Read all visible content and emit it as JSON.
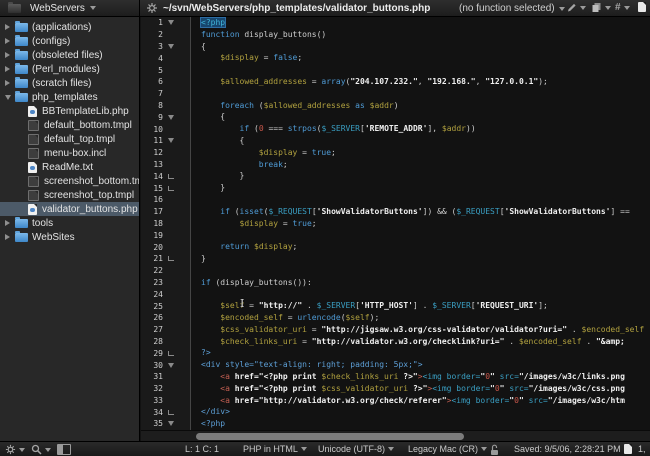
{
  "titlebar": {
    "sidebar_title": "WebServers",
    "path": "~/svn/WebServers/php_templates/validator_buttons.php",
    "function_selector": "(no function selected)",
    "tool_icons": [
      "gear-icon",
      "pencil-icon",
      "copy-icon",
      "hash-icon",
      "document-icon"
    ]
  },
  "sidebar": {
    "items": [
      {
        "label": "(applications)",
        "icon": "folder",
        "disclosure": "collapsed",
        "indent": 0,
        "selected": false
      },
      {
        "label": "(configs)",
        "icon": "folder",
        "disclosure": "collapsed",
        "indent": 0,
        "selected": false
      },
      {
        "label": "(obsoleted files)",
        "icon": "folder",
        "disclosure": "collapsed",
        "indent": 0,
        "selected": false
      },
      {
        "label": "(Perl_modules)",
        "icon": "folder",
        "disclosure": "collapsed",
        "indent": 0,
        "selected": false
      },
      {
        "label": "(scratch files)",
        "icon": "folder",
        "disclosure": "collapsed",
        "indent": 0,
        "selected": false
      },
      {
        "label": "php_templates",
        "icon": "folder",
        "disclosure": "expanded",
        "indent": 0,
        "selected": false
      },
      {
        "label": "BBTemplateLib.php",
        "icon": "doc-php",
        "disclosure": "none",
        "indent": 1,
        "selected": false
      },
      {
        "label": "default_bottom.tmpl",
        "icon": "doc-dark",
        "disclosure": "none",
        "indent": 1,
        "selected": false
      },
      {
        "label": "default_top.tmpl",
        "icon": "doc-dark",
        "disclosure": "none",
        "indent": 1,
        "selected": false
      },
      {
        "label": "menu-box.incl",
        "icon": "doc-dark",
        "disclosure": "none",
        "indent": 1,
        "selected": false
      },
      {
        "label": "ReadMe.txt",
        "icon": "doc-php",
        "disclosure": "none",
        "indent": 1,
        "selected": false
      },
      {
        "label": "screenshot_bottom.tmpl",
        "icon": "doc-dark",
        "disclosure": "none",
        "indent": 1,
        "selected": false
      },
      {
        "label": "screenshot_top.tmpl",
        "icon": "doc-dark",
        "disclosure": "none",
        "indent": 1,
        "selected": false
      },
      {
        "label": "validator_buttons.php",
        "icon": "doc-php",
        "disclosure": "none",
        "indent": 1,
        "selected": true
      },
      {
        "label": "tools",
        "icon": "folder",
        "disclosure": "collapsed",
        "indent": 0,
        "selected": false
      },
      {
        "label": "WebSites",
        "icon": "folder",
        "disclosure": "collapsed",
        "indent": 0,
        "selected": false
      }
    ]
  },
  "editor": {
    "lines": [
      {
        "n": 1,
        "fold": "open",
        "segs": [
          {
            "t": "<?php",
            "c": "phpsel"
          }
        ]
      },
      {
        "n": 2,
        "fold": "",
        "segs": [
          {
            "t": "function",
            "c": "k"
          },
          {
            "t": " display_buttons()",
            "c": "p"
          }
        ]
      },
      {
        "n": 3,
        "fold": "open",
        "segs": [
          {
            "t": "{",
            "c": "p"
          }
        ]
      },
      {
        "n": 4,
        "fold": "",
        "segs": [
          {
            "t": "    ",
            "c": "p"
          },
          {
            "t": "$display",
            "c": "v"
          },
          {
            "t": " = ",
            "c": "p"
          },
          {
            "t": "false",
            "c": "k"
          },
          {
            "t": ";",
            "c": "p"
          }
        ]
      },
      {
        "n": 5,
        "fold": "",
        "segs": []
      },
      {
        "n": 6,
        "fold": "",
        "segs": [
          {
            "t": "    ",
            "c": "p"
          },
          {
            "t": "$allowed_addresses",
            "c": "v"
          },
          {
            "t": " = ",
            "c": "p"
          },
          {
            "t": "array",
            "c": "k"
          },
          {
            "t": "(",
            "c": "p"
          },
          {
            "t": "\"204.107.232.\"",
            "c": "s"
          },
          {
            "t": ", ",
            "c": "p"
          },
          {
            "t": "\"192.168.\"",
            "c": "s"
          },
          {
            "t": ", ",
            "c": "p"
          },
          {
            "t": "\"127.0.0.1\"",
            "c": "s"
          },
          {
            "t": ");",
            "c": "p"
          }
        ]
      },
      {
        "n": 7,
        "fold": "",
        "segs": []
      },
      {
        "n": 8,
        "fold": "",
        "segs": [
          {
            "t": "    ",
            "c": "p"
          },
          {
            "t": "foreach",
            "c": "k"
          },
          {
            "t": " (",
            "c": "p"
          },
          {
            "t": "$allowed_addresses",
            "c": "v"
          },
          {
            "t": " ",
            "c": "p"
          },
          {
            "t": "as",
            "c": "k"
          },
          {
            "t": " ",
            "c": "p"
          },
          {
            "t": "$addr",
            "c": "v"
          },
          {
            "t": ")",
            "c": "p"
          }
        ]
      },
      {
        "n": 9,
        "fold": "open",
        "segs": [
          {
            "t": "    {",
            "c": "p"
          }
        ]
      },
      {
        "n": 10,
        "fold": "",
        "segs": [
          {
            "t": "        ",
            "c": "p"
          },
          {
            "t": "if",
            "c": "k"
          },
          {
            "t": " (",
            "c": "p"
          },
          {
            "t": "0",
            "c": "n"
          },
          {
            "t": " === ",
            "c": "p"
          },
          {
            "t": "strpos",
            "c": "k"
          },
          {
            "t": "(",
            "c": "p"
          },
          {
            "t": "$_SERVER",
            "c": "g"
          },
          {
            "t": "[",
            "c": "p"
          },
          {
            "t": "'REMOTE_ADDR'",
            "c": "s"
          },
          {
            "t": "], ",
            "c": "p"
          },
          {
            "t": "$addr",
            "c": "v"
          },
          {
            "t": "))",
            "c": "p"
          }
        ]
      },
      {
        "n": 11,
        "fold": "open",
        "segs": [
          {
            "t": "        {",
            "c": "p"
          }
        ]
      },
      {
        "n": 12,
        "fold": "",
        "segs": [
          {
            "t": "            ",
            "c": "p"
          },
          {
            "t": "$display",
            "c": "v"
          },
          {
            "t": " = ",
            "c": "p"
          },
          {
            "t": "true",
            "c": "k"
          },
          {
            "t": ";",
            "c": "p"
          }
        ]
      },
      {
        "n": 13,
        "fold": "",
        "segs": [
          {
            "t": "            ",
            "c": "p"
          },
          {
            "t": "break",
            "c": "k"
          },
          {
            "t": ";",
            "c": "p"
          }
        ]
      },
      {
        "n": 14,
        "fold": "end",
        "segs": [
          {
            "t": "        }",
            "c": "p"
          }
        ]
      },
      {
        "n": 15,
        "fold": "end",
        "segs": [
          {
            "t": "    }",
            "c": "p"
          }
        ]
      },
      {
        "n": 16,
        "fold": "",
        "segs": []
      },
      {
        "n": 17,
        "fold": "",
        "segs": [
          {
            "t": "    ",
            "c": "p"
          },
          {
            "t": "if",
            "c": "k"
          },
          {
            "t": " (",
            "c": "p"
          },
          {
            "t": "isset",
            "c": "k"
          },
          {
            "t": "(",
            "c": "p"
          },
          {
            "t": "$_REQUEST",
            "c": "g"
          },
          {
            "t": "[",
            "c": "p"
          },
          {
            "t": "'ShowValidatorButtons'",
            "c": "s"
          },
          {
            "t": "]) && (",
            "c": "p"
          },
          {
            "t": "$_REQUEST",
            "c": "g"
          },
          {
            "t": "[",
            "c": "p"
          },
          {
            "t": "'ShowValidatorButtons'",
            "c": "s"
          },
          {
            "t": "] ==",
            "c": "p"
          }
        ]
      },
      {
        "n": 18,
        "fold": "",
        "segs": [
          {
            "t": "        ",
            "c": "p"
          },
          {
            "t": "$display",
            "c": "v"
          },
          {
            "t": " = ",
            "c": "p"
          },
          {
            "t": "true",
            "c": "k"
          },
          {
            "t": ";",
            "c": "p"
          }
        ]
      },
      {
        "n": 19,
        "fold": "",
        "segs": []
      },
      {
        "n": 20,
        "fold": "",
        "segs": [
          {
            "t": "    ",
            "c": "p"
          },
          {
            "t": "return",
            "c": "k"
          },
          {
            "t": " ",
            "c": "p"
          },
          {
            "t": "$display",
            "c": "v"
          },
          {
            "t": ";",
            "c": "p"
          }
        ]
      },
      {
        "n": 21,
        "fold": "end",
        "segs": [
          {
            "t": "}",
            "c": "p"
          }
        ]
      },
      {
        "n": 22,
        "fold": "",
        "segs": []
      },
      {
        "n": 23,
        "fold": "",
        "segs": [
          {
            "t": "if",
            "c": "k"
          },
          {
            "t": " (display_buttons()):",
            "c": "p"
          }
        ]
      },
      {
        "n": 24,
        "fold": "",
        "segs": []
      },
      {
        "n": 25,
        "fold": "",
        "segs": [
          {
            "t": "    ",
            "c": "p"
          },
          {
            "t": "$self",
            "c": "v"
          },
          {
            "t": " = ",
            "c": "p"
          },
          {
            "t": "\"http://\"",
            "c": "s"
          },
          {
            "t": " . ",
            "c": "p"
          },
          {
            "t": "$_SERVER",
            "c": "g"
          },
          {
            "t": "[",
            "c": "p"
          },
          {
            "t": "'HTTP_HOST'",
            "c": "s"
          },
          {
            "t": "] . ",
            "c": "p"
          },
          {
            "t": "$_SERVER",
            "c": "g"
          },
          {
            "t": "[",
            "c": "p"
          },
          {
            "t": "'REQUEST_URI'",
            "c": "s"
          },
          {
            "t": "];",
            "c": "p"
          }
        ]
      },
      {
        "n": 26,
        "fold": "",
        "segs": [
          {
            "t": "    ",
            "c": "p"
          },
          {
            "t": "$encoded_self",
            "c": "v"
          },
          {
            "t": " = ",
            "c": "p"
          },
          {
            "t": "urlencode",
            "c": "k"
          },
          {
            "t": "(",
            "c": "p"
          },
          {
            "t": "$self",
            "c": "v"
          },
          {
            "t": ");",
            "c": "p"
          }
        ]
      },
      {
        "n": 27,
        "fold": "",
        "segs": [
          {
            "t": "    ",
            "c": "p"
          },
          {
            "t": "$css_validator_uri",
            "c": "v"
          },
          {
            "t": " = ",
            "c": "p"
          },
          {
            "t": "\"http://jigsaw.w3.org/css-validator/validator?uri=\"",
            "c": "s"
          },
          {
            "t": " . ",
            "c": "p"
          },
          {
            "t": "$encoded_self",
            "c": "v"
          }
        ]
      },
      {
        "n": 28,
        "fold": "",
        "segs": [
          {
            "t": "    ",
            "c": "p"
          },
          {
            "t": "$check_links_uri",
            "c": "v"
          },
          {
            "t": " = ",
            "c": "p"
          },
          {
            "t": "\"http://validator.w3.org/checklink?uri=\"",
            "c": "s"
          },
          {
            "t": " . ",
            "c": "p"
          },
          {
            "t": "$encoded_self",
            "c": "v"
          },
          {
            "t": " . ",
            "c": "p"
          },
          {
            "t": "\"&amp;",
            "c": "s"
          }
        ]
      },
      {
        "n": 29,
        "fold": "end",
        "segs": [
          {
            "t": "?>",
            "c": "t"
          }
        ]
      },
      {
        "n": 30,
        "fold": "open",
        "segs": [
          {
            "t": "<div style=\"text-align: right; padding: 5px;\">",
            "c": "t"
          }
        ]
      },
      {
        "n": 31,
        "fold": "",
        "segs": [
          {
            "t": "    ",
            "c": "p"
          },
          {
            "t": "<a",
            "c": "a"
          },
          {
            "t": " href=\"<?php print ",
            "c": "s"
          },
          {
            "t": "$check_links_uri",
            "c": "v"
          },
          {
            "t": " ?>\"",
            "c": "s"
          },
          {
            "t": ">",
            "c": "a"
          },
          {
            "t": "<img",
            "c": "i"
          },
          {
            "t": " border=",
            "c": "i"
          },
          {
            "t": "\"",
            "c": "s"
          },
          {
            "t": "0",
            "c": "n"
          },
          {
            "t": "\"",
            "c": "s"
          },
          {
            "t": " src=",
            "c": "i"
          },
          {
            "t": "\"/images/w3c/links.png",
            "c": "s"
          }
        ]
      },
      {
        "n": 32,
        "fold": "",
        "segs": [
          {
            "t": "    ",
            "c": "p"
          },
          {
            "t": "<a",
            "c": "a"
          },
          {
            "t": " href=\"<?php print ",
            "c": "s"
          },
          {
            "t": "$css_validator_uri",
            "c": "v"
          },
          {
            "t": " ?>\"",
            "c": "s"
          },
          {
            "t": ">",
            "c": "a"
          },
          {
            "t": "<img",
            "c": "i"
          },
          {
            "t": " border=",
            "c": "i"
          },
          {
            "t": "\"",
            "c": "s"
          },
          {
            "t": "0",
            "c": "n"
          },
          {
            "t": "\"",
            "c": "s"
          },
          {
            "t": " src=",
            "c": "i"
          },
          {
            "t": "\"/images/w3c/css.png",
            "c": "s"
          }
        ]
      },
      {
        "n": 33,
        "fold": "",
        "segs": [
          {
            "t": "    ",
            "c": "p"
          },
          {
            "t": "<a",
            "c": "a"
          },
          {
            "t": " href=\"http://validator.w3.org/check/referer\"",
            "c": "s"
          },
          {
            "t": ">",
            "c": "a"
          },
          {
            "t": "<img",
            "c": "i"
          },
          {
            "t": " border=",
            "c": "i"
          },
          {
            "t": "\"",
            "c": "s"
          },
          {
            "t": "0",
            "c": "n"
          },
          {
            "t": "\"",
            "c": "s"
          },
          {
            "t": " src=",
            "c": "i"
          },
          {
            "t": "\"/images/w3c/htm",
            "c": "s"
          }
        ]
      },
      {
        "n": 34,
        "fold": "end",
        "segs": [
          {
            "t": "</div>",
            "c": "t"
          }
        ]
      },
      {
        "n": 35,
        "fold": "open",
        "segs": [
          {
            "t": "<?php",
            "c": "t"
          }
        ]
      }
    ]
  },
  "statusbar": {
    "cursor_position": "L: 1 C: 1",
    "language": "PHP in HTML",
    "encoding": "Unicode (UTF-8)",
    "line_endings": "Legacy Mac (CR)",
    "saved": "Saved: 9/5/06, 2:28:21 PM",
    "pages": "1,",
    "left_icons": [
      "gear-icon",
      "search-icon",
      "sidebar-toggle-icon"
    ]
  },
  "colors": {
    "keyword": "#4f9bd5",
    "variable": "#b1a13f",
    "string": "#f0f0f0",
    "plain": "#cfcfcf",
    "superglobal": "#3a9fc3",
    "number": "#c9574a",
    "tag_red": "#c35f52",
    "tag_cyan": "#3a9fc3",
    "tag_blue": "#5d9fd6",
    "php_tag": "#3fb5d8",
    "selection_bg": "#17466e",
    "sidebar_selected_bg": "#4c5a68"
  }
}
